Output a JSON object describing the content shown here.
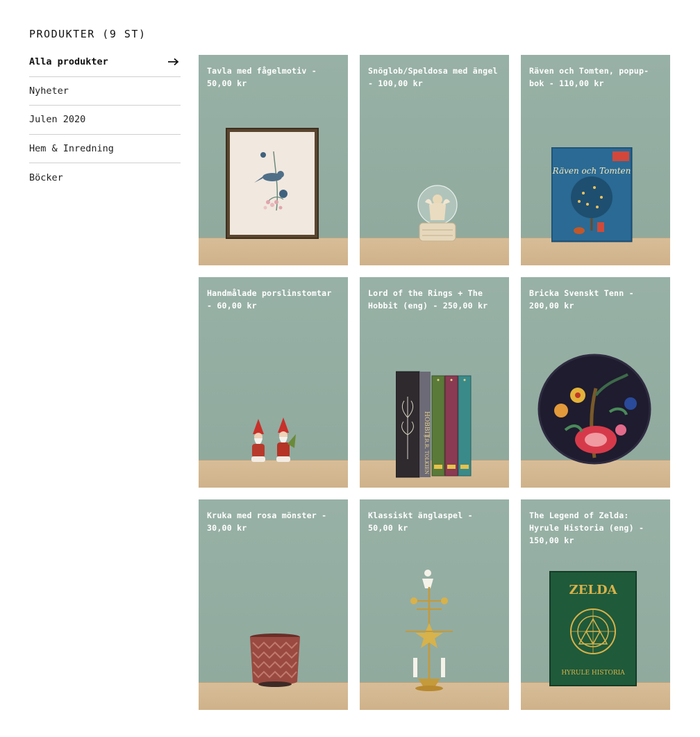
{
  "page": {
    "heading": "PRODUKTER (9 ST)"
  },
  "sidebar": {
    "items": [
      {
        "label": "Alla produkter",
        "active": true
      },
      {
        "label": "Nyheter"
      },
      {
        "label": "Julen 2020"
      },
      {
        "label": "Hem & Inredning"
      },
      {
        "label": "Böcker"
      }
    ]
  },
  "products": [
    {
      "title": "Tavla med fågelmotiv - 50,00 kr",
      "item": "framed-bird-painting"
    },
    {
      "title": "Snöglob/Speldosa med ängel - 100,00 kr",
      "item": "angel-snow-globe"
    },
    {
      "title": "Räven och Tomten, popup-bok - 110,00 kr",
      "item": "popup-book",
      "book_title": "Räven och Tomten"
    },
    {
      "title": "Handmålade porslinstomtar - 60,00 kr",
      "item": "porcelain-gnomes"
    },
    {
      "title": "Lord of the Rings + The Hobbit (eng) - 250,00 kr",
      "item": "book-box-set",
      "book_title": "HOBBIT",
      "book_author": "J.R.R. TOLKIEN"
    },
    {
      "title": "Bricka Svenskt Tenn - 200,00 kr",
      "item": "floral-tray"
    },
    {
      "title": "Kruka med rosa mönster - 30,00 kr",
      "item": "pink-pattern-pot"
    },
    {
      "title": "Klassiskt änglaspel - 50,00 kr",
      "item": "angel-chimes"
    },
    {
      "title": "The Legend of Zelda: Hyrule Historia (eng) - 150,00 kr",
      "item": "zelda-book",
      "book_title": "ZELDA",
      "book_subtitle": "HYRULE HISTORIA"
    }
  ],
  "colors": {
    "wall": "#93ada1",
    "shelf": "#d5b993",
    "text": "#111111"
  }
}
